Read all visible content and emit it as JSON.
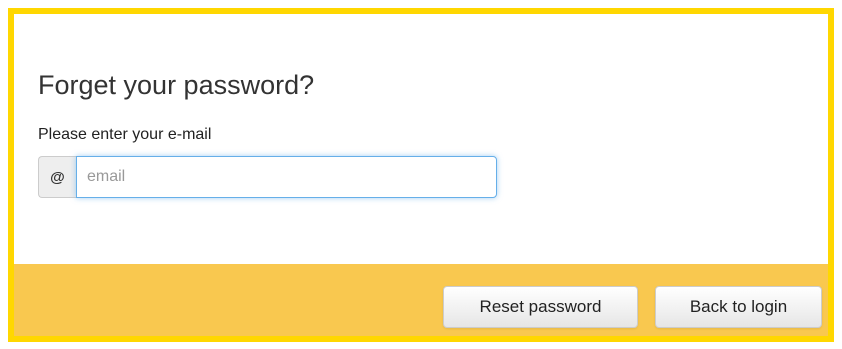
{
  "dialog": {
    "title": "Forget your password?",
    "prompt": "Please enter your e-mail",
    "email": {
      "addon": "@",
      "value": "",
      "placeholder": "email"
    },
    "buttons": {
      "reset": "Reset password",
      "back": "Back to login"
    }
  },
  "colors": {
    "border": "#FFD700",
    "footer": "#F9C84F",
    "focus": "#66afe9"
  }
}
